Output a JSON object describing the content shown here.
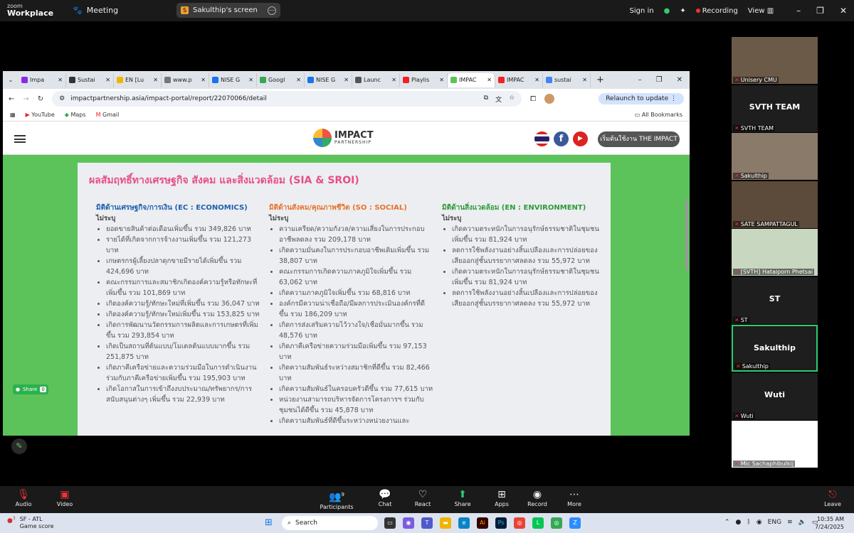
{
  "zoom": {
    "brand_top": "zoom",
    "brand_bottom": "Workplace",
    "meeting_label": "Meeting",
    "share_label": "Sakulthip's screen",
    "share_initial": "S",
    "sign_in": "Sign in",
    "recording": "Recording",
    "view": "View"
  },
  "browser": {
    "tabs": [
      {
        "label": "Impa",
        "color": "#8a2be2"
      },
      {
        "label": "Sustai",
        "color": "#333"
      },
      {
        "label": "EN [Lu",
        "color": "#f0b400"
      },
      {
        "label": "www.p",
        "color": "#777"
      },
      {
        "label": "NISE G",
        "color": "#1a73e8"
      },
      {
        "label": "Googl",
        "color": "#34a853"
      },
      {
        "label": "NISE G",
        "color": "#1a73e8"
      },
      {
        "label": "Launc",
        "color": "#555"
      },
      {
        "label": "Playlis",
        "color": "#e22"
      },
      {
        "label": "IMPAC",
        "color": "#5cc35a"
      },
      {
        "label": "IMPAC",
        "color": "#e22"
      },
      {
        "label": "sustai",
        "color": "#4285f4"
      }
    ],
    "url": "impactpartnership.asia/impact-portal/report/22070066/detail",
    "relaunch": "Relaunch to update",
    "bookmarks": [
      "YouTube",
      "Maps",
      "Gmail"
    ],
    "all_bookmarks": "All Bookmarks"
  },
  "site": {
    "logo_main": "IMPACT",
    "logo_sub": "PARTNERSHIP",
    "start_button": "เริ่มต้นใช้งาน THE IMPACT",
    "card_title": "ผลสัมฤทธิ์ทางเศรษฐกิจ สังคม และสิ่งแวดล้อม (SIA & SROI)",
    "not_specified": "ไม่ระบุ",
    "columns": [
      {
        "heading": "มิติด้านเศรษฐกิจ/การเงิน (EC : ECONOMICS)",
        "color": "#1f5fb0",
        "items": [
          "ยอดขายสินค้าต่อเดือนเพิ่มขึ้น รวม 349,826 บาท",
          "รายได้ที่เกิดจากการจ้างงานเพิ่มขึ้น รวม 121,273 บาท",
          "เกษตรกรผู้เลี้ยงปลาดุกขายมีรายได้เพิ่มขึ้น รวม 424,696 บาท",
          "คณะกรรมการและสมาชิกเกิดองค์ความรู้หรือทักษะที่เพิ่มขึ้น รวม 101,869 บาท",
          "เกิดองค์ความรู้/ทักษะใหม่ที่เพิ่มขึ้น รวม 36,047 บาท",
          "เกิดองค์ความรู้/ทักษะใหม่เพิ่มขึ้น รวม 153,825 บาท",
          "เกิดการพัฒนานวัตกรรมการผลิตและการเกษตรที่เพิ่มขึ้น รวม 293,854 บาท",
          "เกิดเป็นสถานที่ต้นแบบ/โมเดลต้นแบบมากขึ้น รวม 251,875 บาท",
          "เกิดภาคีเครือข่ายและความร่วมมือในการดำเนินงานร่วมกับภาคีเครือข่ายเพิ่มขึ้น รวม 195,903 บาท",
          "เกิดโอกาสในการเข้าถึงงบประมาณ/ทรัพยากร/การสนับสนุนต่างๆ เพิ่มขึ้น รวม 22,939 บาท"
        ]
      },
      {
        "heading": "มิติด้านสังคม/คุณภาพชีวิต (SO : SOCIAL)",
        "color": "#e8722a",
        "items": [
          "ความเครียด/ความกังวล/ความเสี่ยงในการประกอบอาชีพลดลง รวม 209,178 บาท",
          "เกิดความมั่นคงในการประกอบอาชีพเดิมเพิ่มขึ้น รวม 38,807 บาท",
          "คณะกรรมการเกิดความภาคภูมิใจเพิ่มขึ้น รวม 63,062 บาท",
          "เกิดความภาคภูมิใจเพิ่มขึ้น รวม 68,816 บาท",
          "องค์กรมีความน่าเชื่อถือ/มีผลการประเมินองค์กรที่ดีขึ้น รวม 186,209 บาท",
          "เกิดการส่งเสริมความไว้วางใจ/เชื่อมั่นมากขึ้น รวม 48,576 บาท",
          "เกิดภาคีเครือข่ายความร่วมมือเพิ่มขึ้น รวม 97,153 บาท",
          "เกิดความสัมพันธ์ระหว่างสมาชิกที่ดีขึ้น รวม 82,466 บาท",
          "เกิดความสัมพันธ์ในครอบครัวดีขึ้น รวม 77,615 บาท",
          "หน่วยงานสามารถบริหารจัดการโครงการฯ ร่วมกับชุมชนได้ดีขึ้น รวม 45,878 บาท",
          "เกิดความสัมพันธ์ที่ดีขึ้นระหว่างหน่วยงานและ"
        ]
      },
      {
        "heading": "มิติด้านสิ่งแวดล้อม (EN : ENVIRONMENT)",
        "color": "#2e9a3a",
        "items": [
          "เกิดความตระหนักในการอนุรักษ์ธรรมชาติในชุมชนเพิ่มขึ้น รวม 81,924 บาท",
          "ลดการใช้พลังงานอย่างสิ้นเปลืองและการปล่อยของเสียออกสู่ชั้นบรรยากาศลดลง รวม 55,972 บาท",
          "เกิดความตระหนักในการอนุรักษ์ธรรมชาติในชุมชนเพิ่มขึ้น รวม 81,924 บาท",
          "ลดการใช้พลังงานอย่างสิ้นเปลืองและการปล่อยของเสียออกสู่ชั้นบรรยากาศลดลง รวม 55,972 บาท"
        ]
      }
    ],
    "share_label": "Share",
    "share_count": "0"
  },
  "participants_tiles": [
    {
      "name": "Unisery CMU",
      "big": "",
      "photo": "#6b5a48"
    },
    {
      "name": "SVTH TEAM",
      "big": "SVTH TEAM",
      "photo": ""
    },
    {
      "name": "Sakulthip",
      "big": "",
      "photo": "#8a7a6a"
    },
    {
      "name": "SATE SAMPATTAGUL",
      "big": "",
      "photo": "#5c4a3a"
    },
    {
      "name": "[SVTH] Hataiporn Phetsai",
      "big": "",
      "photo": "#c8d8c0"
    },
    {
      "name": "ST",
      "big": "ST",
      "photo": ""
    },
    {
      "name": "Sakulthip",
      "big": "Sakulthip",
      "photo": "",
      "highlight": true
    },
    {
      "name": "Wuti",
      "big": "Wuti",
      "photo": ""
    },
    {
      "name": "Mic Sachaphibulkij",
      "big": "",
      "photo": "#ffffff"
    }
  ],
  "controls": {
    "audio": "Audio",
    "video": "Video",
    "participants": "Participants",
    "participants_count": "9",
    "chat": "Chat",
    "react": "React",
    "share": "Share",
    "apps": "Apps",
    "record": "Record",
    "more": "More",
    "leave": "Leave"
  },
  "taskbar": {
    "weather_title": "SF - ATL",
    "weather_sub": "Game score",
    "badge": "3",
    "search": "Search",
    "lang": "ENG",
    "time": "10:35 AM",
    "date": "7/24/2025"
  }
}
